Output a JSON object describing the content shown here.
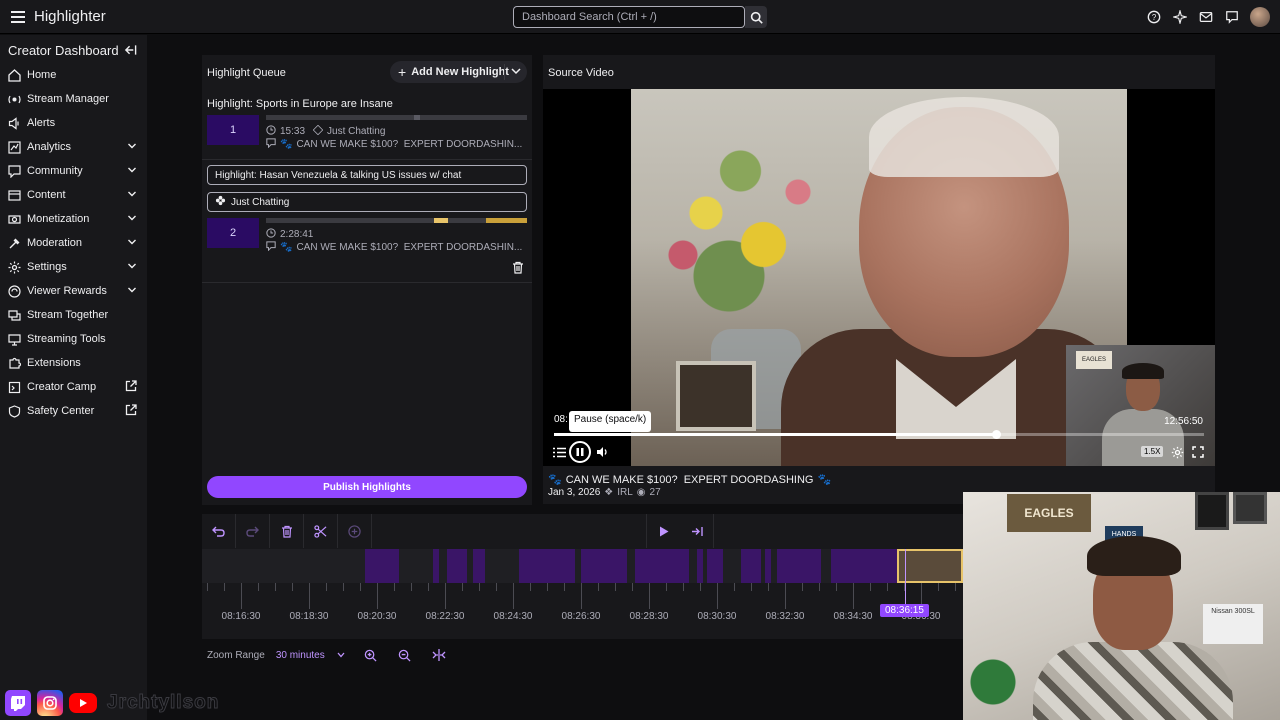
{
  "app": {
    "title": "Highlighter"
  },
  "search": {
    "placeholder": "Dashboard Search (Ctrl + /)"
  },
  "sidebar": {
    "heading": "Creator Dashboard",
    "items": [
      {
        "label": "Home",
        "icon": "home-icon",
        "expandable": false,
        "external": false
      },
      {
        "label": "Stream Manager",
        "icon": "stream-manager-icon",
        "expandable": false,
        "external": false
      },
      {
        "label": "Alerts",
        "icon": "alerts-icon",
        "expandable": false,
        "external": false
      },
      {
        "label": "Analytics",
        "icon": "analytics-icon",
        "expandable": true,
        "external": false
      },
      {
        "label": "Community",
        "icon": "community-icon",
        "expandable": true,
        "external": false
      },
      {
        "label": "Content",
        "icon": "content-icon",
        "expandable": true,
        "external": false
      },
      {
        "label": "Monetization",
        "icon": "monetization-icon",
        "expandable": true,
        "external": false
      },
      {
        "label": "Moderation",
        "icon": "moderation-icon",
        "expandable": true,
        "external": false
      },
      {
        "label": "Settings",
        "icon": "settings-icon",
        "expandable": true,
        "external": false
      },
      {
        "label": "Viewer Rewards",
        "icon": "viewer-rewards-icon",
        "expandable": true,
        "external": false
      },
      {
        "label": "Stream Together",
        "icon": "stream-together-icon",
        "expandable": false,
        "external": false
      },
      {
        "label": "Streaming Tools",
        "icon": "streaming-tools-icon",
        "expandable": false,
        "external": false
      },
      {
        "label": "Extensions",
        "icon": "extensions-icon",
        "expandable": false,
        "external": false
      },
      {
        "label": "Creator Camp",
        "icon": "creator-camp-icon",
        "expandable": false,
        "external": true
      },
      {
        "label": "Safety Center",
        "icon": "safety-center-icon",
        "expandable": false,
        "external": true
      }
    ]
  },
  "queue": {
    "heading": "Highlight Queue",
    "add_button": "Add New Highlight",
    "publish_button": "Publish Highlights",
    "highlights": [
      {
        "title": "Highlight: Sports in Europe are Insane",
        "index": "1",
        "duration": "15:33",
        "category": "Just Chatting",
        "stream_title": "CAN WE MAKE $100?  EXPERT DOORDASHIN..."
      },
      {
        "title": "Highlight: Hasan Venezuela & talking US issues w/ chat",
        "index": "2",
        "duration": "2:28:41",
        "category": "Just Chatting",
        "stream_title": "CAN WE MAKE $100?  EXPERT DOORDASHIN..."
      }
    ]
  },
  "source": {
    "heading": "Source Video",
    "tooltip": "Pause (space/k)",
    "time_current": "08:",
    "time_total": "12:56:50",
    "playback_progress": 0.68,
    "speed": "1.5X",
    "video_title": "CAN WE MAKE $100?  EXPERT DOORDASHING",
    "date": "Jan 3, 2026",
    "category": "IRL",
    "views": "27",
    "overlay_sign": "EAGLES"
  },
  "timeline": {
    "ticks": [
      "08:16:30",
      "08:18:30",
      "08:20:30",
      "08:22:30",
      "08:24:30",
      "08:26:30",
      "08:28:30",
      "08:30:30",
      "08:32:30",
      "08:34:30",
      "08:36:30"
    ],
    "playhead": "08:36:15"
  },
  "zoom": {
    "label": "Zoom Range",
    "value": "30 minutes"
  },
  "webcam": {
    "banner": "EAGLES",
    "sign": "HANDS OFF",
    "car": "Nissan 300SL"
  },
  "socials": {
    "handle": "Jrchtyllson"
  },
  "colors": {
    "accent": "#9147ff",
    "selected_segment": "#e8c46a",
    "segment": "#3a1567"
  }
}
